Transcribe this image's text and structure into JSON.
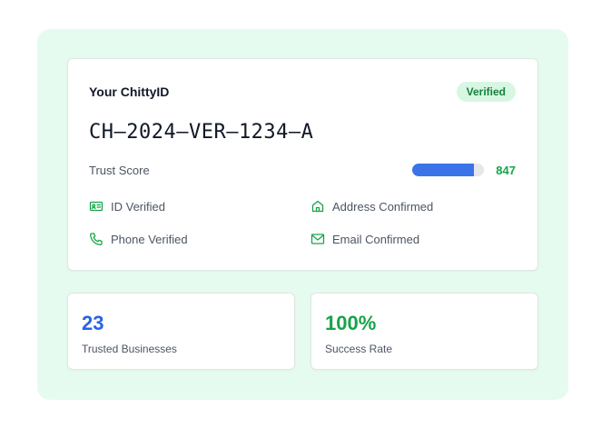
{
  "card": {
    "title": "Your ChittyID",
    "badge": "Verified",
    "id": "CH—2024—VER—1234—A",
    "trust_label": "Trust Score",
    "trust_value": "847",
    "trust_fill_fraction": 0.86,
    "verifications": [
      {
        "label": "ID Verified",
        "icon": "id-card-icon"
      },
      {
        "label": "Address Confirmed",
        "icon": "home-icon"
      },
      {
        "label": "Phone Verified",
        "icon": "phone-icon"
      },
      {
        "label": "Email Confirmed",
        "icon": "mail-icon"
      }
    ]
  },
  "stats": [
    {
      "value": "23",
      "label": "Trusted Businesses"
    },
    {
      "value": "100%",
      "label": "Success Rate"
    }
  ],
  "colors": {
    "accent_green": "#16a34a",
    "accent_blue": "#2563eb",
    "bar_blue": "#3b73e8",
    "panel_bg": "#e6fbef"
  }
}
